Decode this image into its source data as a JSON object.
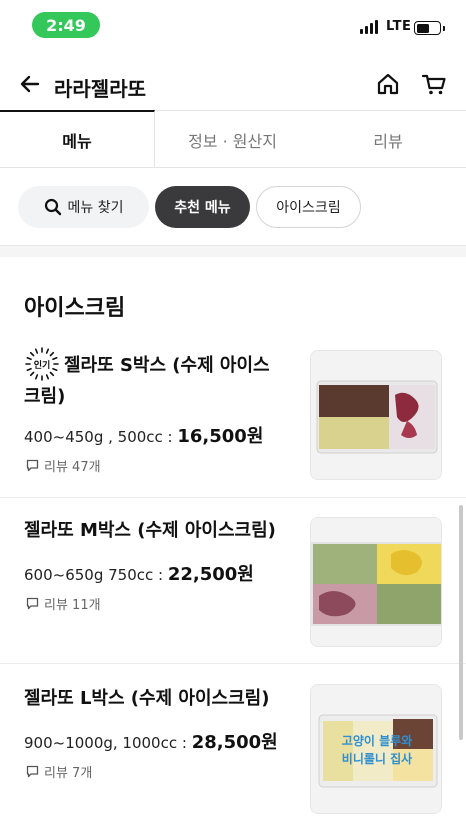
{
  "status_bar": {
    "time": "2:49",
    "network": "LTE"
  },
  "header": {
    "store_name": "라라젤라또"
  },
  "tabs": [
    {
      "label": "메뉴",
      "active": true
    },
    {
      "label": "정보 · 원산지",
      "active": false
    },
    {
      "label": "리뷰",
      "active": false
    }
  ],
  "chips": {
    "search_label": "메뉴 찾기",
    "recommended_label": "추천 메뉴",
    "icecream_label": "아이스크림"
  },
  "section": {
    "title": "아이스크림"
  },
  "items": [
    {
      "badge": "인기",
      "name": "젤라또 S박스 (수제 아이스크림)",
      "name_line1": "젤라또 S박스 (수제 아이스",
      "name_line2": "크림)",
      "spec": "400~450g , 500cc : ",
      "price": "16,500원",
      "reviews": "리뷰 47개"
    },
    {
      "name": "젤라또 M박스 (수제 아이스크림)",
      "spec": "600~650g 750cc : ",
      "price": "22,500원",
      "reviews": "리뷰 11개"
    },
    {
      "name": "젤라또 L박스 (수제 아이스크림)",
      "spec": "900~1000g, 1000cc : ",
      "price": "28,500원",
      "reviews": "리뷰 7개"
    }
  ],
  "thumb3_text": {
    "line1": "고양이 블루와",
    "line2": "비니롤니 집사"
  },
  "colors": {
    "status_pill": "#34c759",
    "chip_selected": "#3a3a3c",
    "chip_search_bg": "#f1f3f5"
  }
}
